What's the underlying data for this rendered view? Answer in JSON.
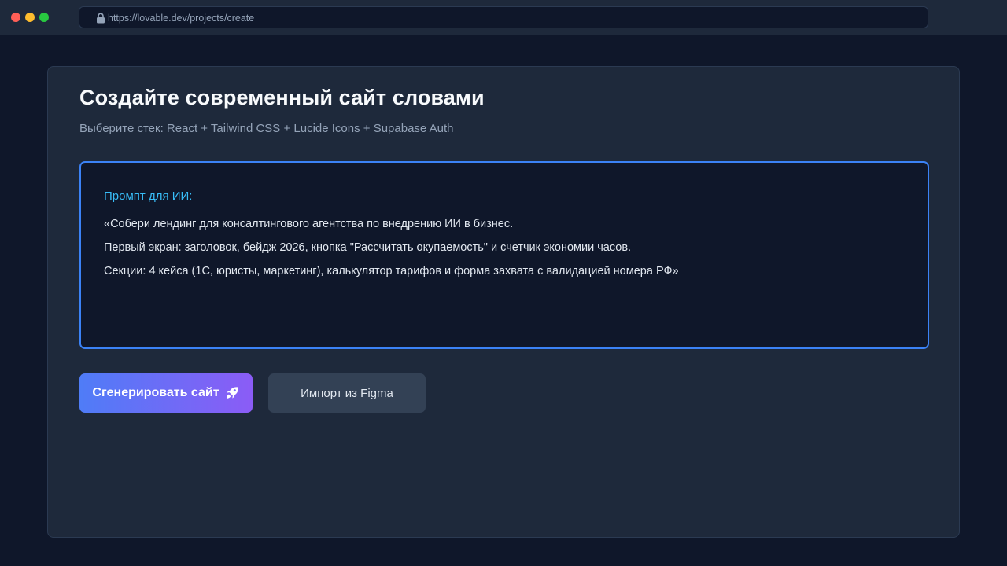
{
  "browser": {
    "url": "https://lovable.dev/projects/create"
  },
  "page": {
    "title": "Создайте современный сайт словами",
    "subtitle": "Выберите стек: React + Tailwind CSS + Lucide Icons + Supabase Auth"
  },
  "prompt": {
    "label": "Промпт для ИИ:",
    "lines": [
      "«Собери лендинг для консалтингового агентства по внедрению ИИ в бизнес.",
      "Первый экран: заголовок, бейдж 2026, кнопка \"Рассчитать окупаемость\" и счетчик экономии часов.",
      "Секции: 4 кейса (1С, юристы, маркетинг), калькулятор тарифов и форма захвата с валидацией номера РФ»"
    ]
  },
  "actions": {
    "generate_label": "Сгенерировать сайт",
    "generate_icon": "rocket-icon",
    "import_label": "Импорт из Figma"
  },
  "colors": {
    "background": "#0f172a",
    "card": "#1e293b",
    "accent_border": "#3b82f6",
    "prompt_label": "#38bdf8",
    "gradient_start": "#4f7cf7",
    "gradient_end": "#8b5cf6"
  }
}
